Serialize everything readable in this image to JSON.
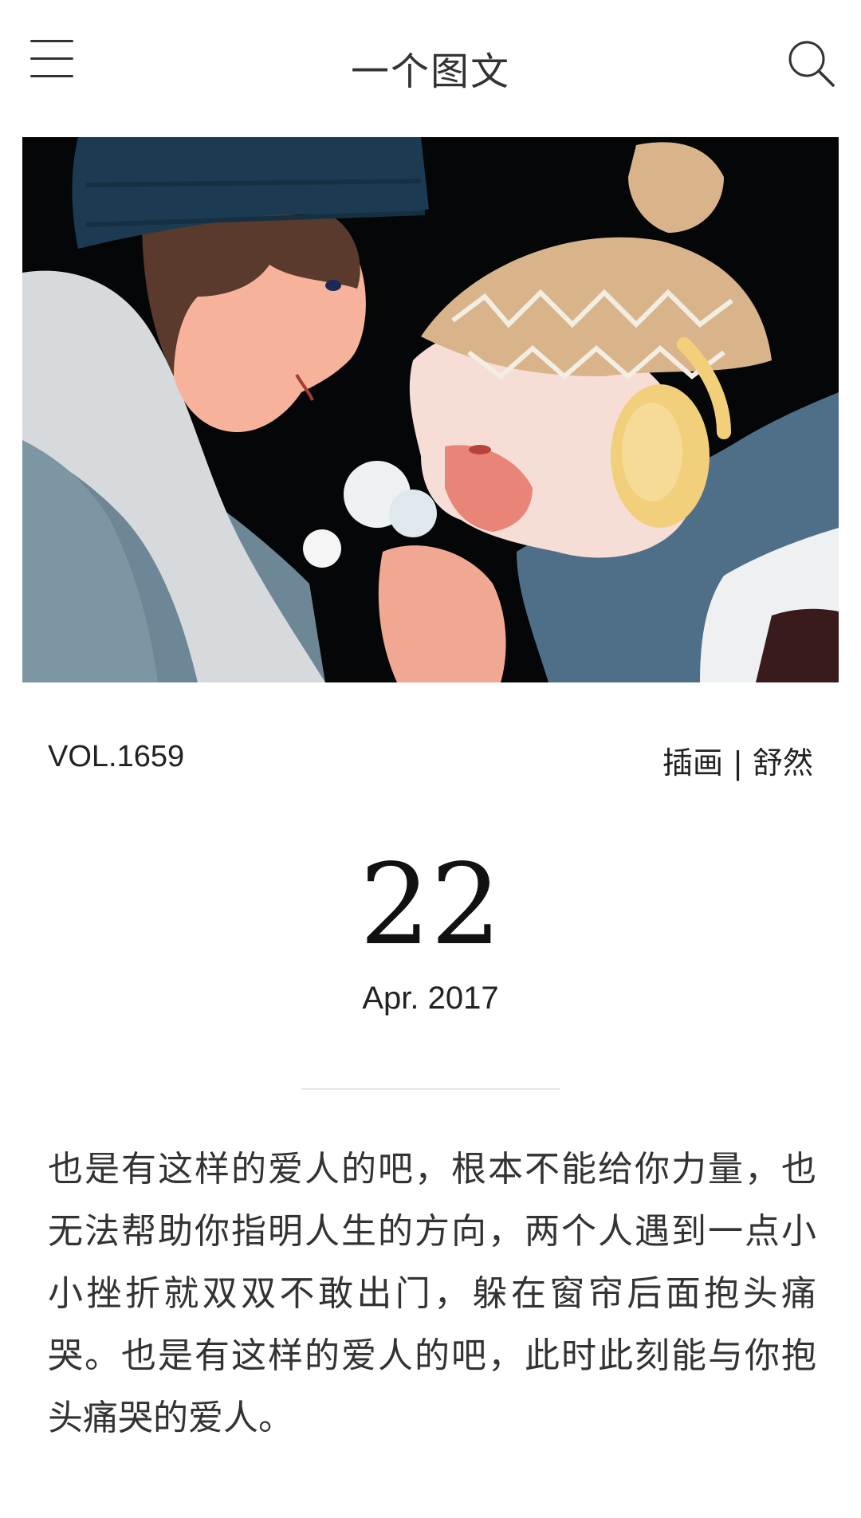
{
  "header": {
    "title": "一个图文",
    "menu_icon": "hamburger-menu-icon",
    "search_icon": "search-icon"
  },
  "hero": {
    "image": "illustration-couple-in-winter"
  },
  "meta": {
    "volume": "VOL.1659",
    "credit": "插画 | 舒然"
  },
  "date": {
    "day": "22",
    "month_year": "Apr. 2017"
  },
  "content": {
    "quote": "也是有这样的爱人的吧，根本不能给你力量，也无法帮助你指明人生的方向，两个人遇到一点小小挫折就双双不敢出门，躲在窗帘后面抱头痛哭。也是有这样的爱人的吧，此时此刻能与你抱头痛哭的爱人。"
  }
}
